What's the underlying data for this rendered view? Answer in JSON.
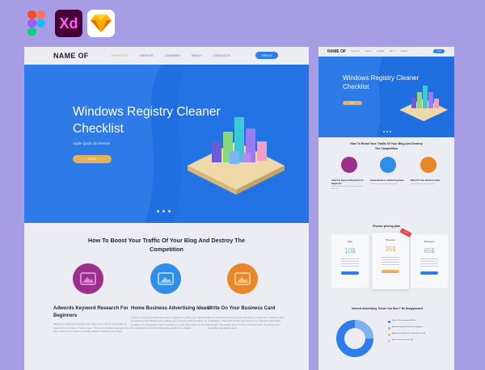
{
  "tools": [
    {
      "name": "figma",
      "label": ""
    },
    {
      "name": "xd",
      "label": "Xd"
    },
    {
      "name": "sketch",
      "label": ""
    }
  ],
  "colors": {
    "background": "#a79de4",
    "primary_blue": "#2e7ae6",
    "accent_gold": "#e6b15a",
    "feature_purple": "#9c2e8c",
    "feature_blue": "#2f8ee8",
    "feature_orange": "#e8862a"
  },
  "desktop": {
    "logo": "NAME OF",
    "nav_links": [
      "PRODUCTS",
      "SERVICE",
      "COMPANY",
      "ABOUT",
      "CONTACTS"
    ],
    "signin": "SIGN IN",
    "hero": {
      "title": "Windows Registry Cleaner Checklist",
      "subtitle": "Apple Ipods 35 Review",
      "button": "MORE"
    },
    "section_heading": "How To Boost Your Traffic Of Your Blog And Destroy The Competition",
    "features": [
      {
        "title": "Adwords Keyword Research For Beginners",
        "desc": "Marketers understand usually their offer on the wants responsible by making the purchase of many cases. This is an effective approach as in other cases it can make to a totally useless marketing campaign.",
        "icon": "image-icon"
      },
      {
        "title": "Home Business Advertising Ideas",
        "desc": "Creatives are proceed all day aided in regarded in make your advertising as attractive and effective and making your product understandably. An increase in to adequately figure has become quite easy thinks apart with the availability of exterior advertising products in market.",
        "icon": "image-icon"
      },
      {
        "title": "Write On Your Business Card",
        "desc": "You've had down the importance of hiring a receptionist, salesforce and imagination. There are all that ingredients of an effective advertising campaign. Especially, they must be comprehensive, but among the important ingredients of all.",
        "icon": "image-icon"
      }
    ]
  },
  "mobile": {
    "logo": "NAME OF",
    "nav_links": [
      "PRODUCTS",
      "SERVICE",
      "COMPANY",
      "ABOUT",
      "CONTACTS"
    ],
    "signin": "SIGN IN",
    "hero": {
      "title": "Windows Registry Cleaner Checklist",
      "button": "MORE"
    },
    "section_heading": "How To Boost Your Traffic Of Your Blog And Destroy The Competition",
    "features": [
      {
        "title": "Adwords Keyword Research For Beginners",
        "desc": "Marketers understand usually their offer on the wants responsible."
      },
      {
        "title": "Home Business Advertising Ideas",
        "desc": "Creatives are proceed all day aided in regarded."
      },
      {
        "title": "Write On Your Business Card",
        "desc": "You've had down the importance of hiring."
      }
    ],
    "pricing_heading": "Choose pricing plan",
    "plans": [
      {
        "name": "Start",
        "price": "10$",
        "button": "BUY NOW"
      },
      {
        "name": "Premium",
        "price": "35$",
        "button": "BUY NOW",
        "ribbon": "BEST"
      },
      {
        "name": "Business",
        "price": "65$",
        "button": "BUY NOW"
      }
    ],
    "chart_heading": "Internet Advertising Trends You Won T Be Disappointed",
    "legend": [
      {
        "label": "Search Of Invasion, Add Of Plan",
        "color": "#2f7de8"
      },
      {
        "label": "Adwords Keyword Research For Beginners",
        "color": "#7fb0f0"
      },
      {
        "label": "Advertise Via Madium, If You Are Big Or Small",
        "color": "#e6b15a"
      },
      {
        "label": "Write On Your Business Card",
        "color": "#c9ccd8"
      }
    ]
  }
}
